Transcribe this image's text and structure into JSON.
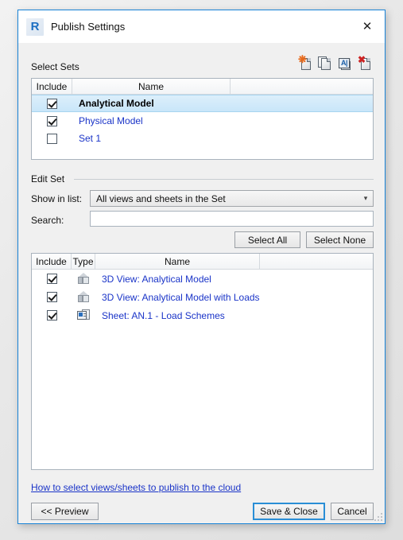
{
  "window": {
    "title": "Publish Settings",
    "logo_letter": "R",
    "close_label": "✕"
  },
  "select_sets": {
    "group_label": "Select Sets",
    "toolbar": [
      {
        "name": "new-set-icon",
        "glyph": "✻",
        "tip": "New"
      },
      {
        "name": "duplicate-set-icon",
        "glyph": "",
        "tip": "Duplicate"
      },
      {
        "name": "rename-set-icon",
        "glyph": "A|",
        "tip": "Rename"
      },
      {
        "name": "delete-set-icon",
        "glyph": "✖",
        "tip": "Delete"
      }
    ],
    "columns": [
      "Include",
      "Name",
      ""
    ],
    "rows": [
      {
        "include": true,
        "name": "Analytical Model",
        "selected": true
      },
      {
        "include": true,
        "name": "Physical Model",
        "selected": false
      },
      {
        "include": false,
        "name": "Set 1",
        "selected": false
      }
    ]
  },
  "edit_set": {
    "group_label": "Edit Set",
    "show_in_list_label": "Show in list:",
    "show_in_list_value": "All views and sheets in the Set",
    "search_label": "Search:",
    "search_value": "",
    "search_placeholder": "",
    "select_all_label": "Select All",
    "select_none_label": "Select None",
    "columns": [
      "Include",
      "Type",
      "Name",
      ""
    ],
    "rows": [
      {
        "include": true,
        "type": "3d-view-icon",
        "name": "3D View: Analytical Model"
      },
      {
        "include": true,
        "type": "3d-view-icon",
        "name": "3D View: Analytical Model with Loads"
      },
      {
        "include": true,
        "type": "sheet-icon",
        "name": "Sheet: AN.1 - Load Schemes"
      }
    ]
  },
  "footer": {
    "help_link": "How to select views/sheets to publish to the cloud",
    "preview_label": "<< Preview",
    "save_label": "Save & Close",
    "cancel_label": "Cancel"
  },
  "colors": {
    "accent": "#1883d7",
    "link": "#1a34c8",
    "selection": "#c9e6f9"
  }
}
